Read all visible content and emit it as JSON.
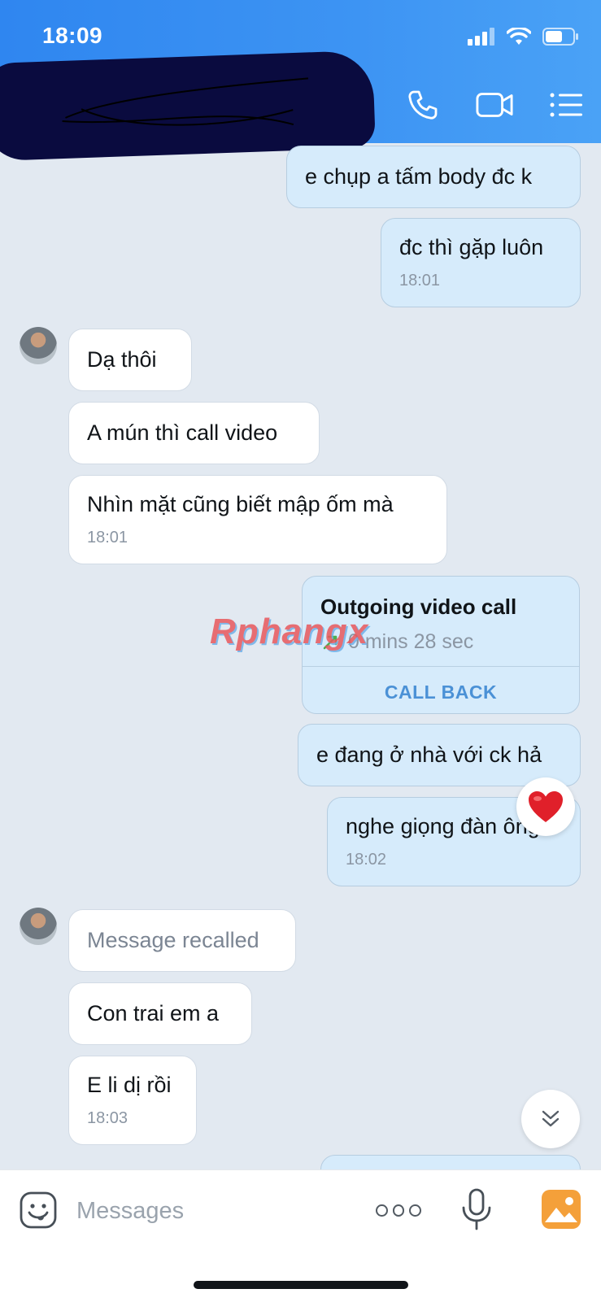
{
  "status_bar": {
    "time": "18:09"
  },
  "messages": [
    {
      "dir": "out",
      "text": "e chụp a tấm body đc k"
    },
    {
      "dir": "out",
      "text": "đc thì gặp luôn",
      "time": "18:01"
    },
    {
      "dir": "in",
      "text": "Dạ thôi"
    },
    {
      "dir": "in",
      "text": "A mún thì call video"
    },
    {
      "dir": "in",
      "text": "Nhìn mặt cũng biết mập ốm mà",
      "time": "18:01"
    },
    {
      "dir": "out",
      "text": "e đang ở nhà với ck hả"
    },
    {
      "dir": "out",
      "text": "nghe giọng đàn ông",
      "time": "18:02"
    },
    {
      "dir": "in",
      "text": "Message recalled"
    },
    {
      "dir": "in",
      "text": "Con trai em a"
    },
    {
      "dir": "in",
      "text": "E li dị rồi",
      "time": "18:03"
    }
  ],
  "call_card": {
    "title": "Outgoing video call",
    "duration": "0 mins 28 sec",
    "action": "CALL BACK"
  },
  "watermark": "Rphangx",
  "input": {
    "placeholder": "Messages"
  },
  "colors": {
    "header": "#3d94f3",
    "outgoing_bubble": "#d6ebfb",
    "incoming_bubble": "#ffffff",
    "call_back": "#4b91d6"
  }
}
